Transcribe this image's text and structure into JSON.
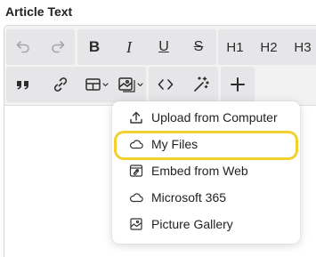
{
  "field_label": "Article Text",
  "toolbar": {
    "row1": [
      {
        "name": "undo-button",
        "icon": "undo-icon",
        "disabled": true
      },
      {
        "name": "redo-button",
        "icon": "redo-icon",
        "disabled": true
      },
      {
        "name": "bold-button",
        "label": "B"
      },
      {
        "name": "italic-button",
        "label": "I"
      },
      {
        "name": "underline-button",
        "label": "U"
      },
      {
        "name": "strikethrough-button",
        "label": "S"
      },
      {
        "name": "heading1-button",
        "label": "H1"
      },
      {
        "name": "heading2-button",
        "label": "H2"
      },
      {
        "name": "heading3-button",
        "label": "H3"
      }
    ],
    "row2": [
      {
        "name": "blockquote-button",
        "icon": "quote-icon"
      },
      {
        "name": "link-button",
        "icon": "link-icon"
      },
      {
        "name": "table-button",
        "icon": "table-icon"
      },
      {
        "name": "image-button",
        "icon": "image-icon"
      },
      {
        "name": "code-button",
        "icon": "code-icon"
      },
      {
        "name": "magic-button",
        "icon": "magic-wand-icon"
      },
      {
        "name": "insert-button",
        "icon": "plus-icon"
      }
    ]
  },
  "image_menu": {
    "items": [
      {
        "label": "Upload from Computer",
        "icon": "upload-icon"
      },
      {
        "label": "My Files",
        "icon": "cloud-icon",
        "highlighted": true
      },
      {
        "label": "Embed from Web",
        "icon": "embed-web-icon"
      },
      {
        "label": "Microsoft 365",
        "icon": "cloud-icon"
      },
      {
        "label": "Picture Gallery",
        "icon": "gallery-icon"
      }
    ]
  },
  "colors": {
    "toolbar_bg": "#f2f2f3",
    "button_group_bg": "#e6e6e8",
    "highlight": "#f4d02f"
  }
}
